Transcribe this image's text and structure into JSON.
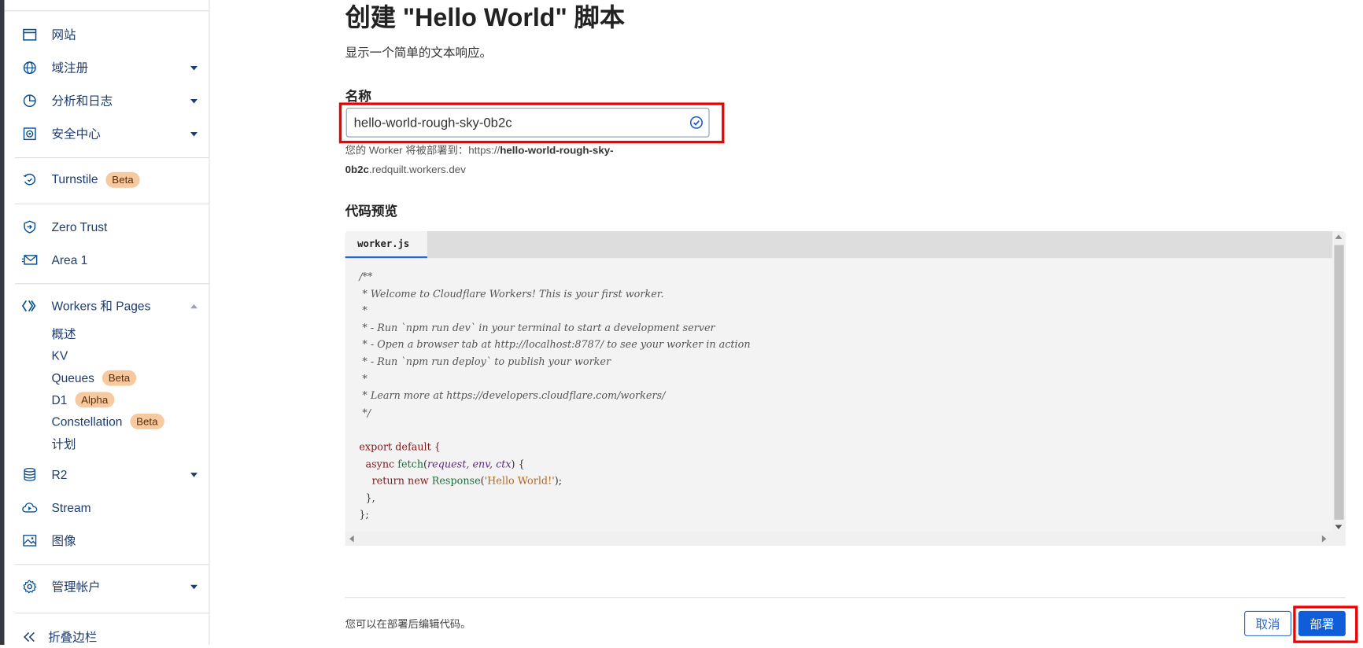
{
  "sidebar": {
    "items": [
      {
        "label": "网站",
        "icon": "browser-window-icon",
        "caret": false
      },
      {
        "label": "域注册",
        "icon": "globe-icon",
        "caret": true
      },
      {
        "label": "分析和日志",
        "icon": "pie-chart-icon",
        "caret": true
      },
      {
        "label": "安全中心",
        "icon": "shield-target-icon",
        "caret": true
      },
      {
        "label": "Turnstile",
        "icon": "turnstile-icon",
        "badge": "Beta"
      },
      {
        "label": "Zero Trust",
        "icon": "zero-trust-icon"
      },
      {
        "label": "Area 1",
        "icon": "envelope-icon"
      },
      {
        "label": "Workers 和 Pages",
        "icon": "workers-icon",
        "caret": "up"
      },
      {
        "label": "R2",
        "icon": "database-icon",
        "caret": true
      },
      {
        "label": "Stream",
        "icon": "cloud-play-icon"
      },
      {
        "label": "图像",
        "icon": "image-icon"
      },
      {
        "label": "管理帐户",
        "icon": "gear-icon",
        "caret": true
      }
    ],
    "workers_sub": [
      {
        "label": "概述"
      },
      {
        "label": "KV"
      },
      {
        "label": "Queues",
        "badge": "Beta"
      },
      {
        "label": "D1",
        "badge": "Alpha"
      },
      {
        "label": "Constellation",
        "badge": "Beta"
      },
      {
        "label": "计划"
      }
    ],
    "collapse_label": "折叠边栏"
  },
  "main": {
    "title": "创建 \"Hello World\" 脚本",
    "subtitle": "显示一个简单的文本响应。",
    "name_label": "名称",
    "name_value": "hello-world-rough-sky-0b2c",
    "deploy_hint_prefix": "您的 Worker 将被部署到：https://",
    "deploy_hint_bold_1": "hello-world-rough-sky-",
    "deploy_hint_bold_2": "0b2c",
    "deploy_hint_suffix": ".redquilt.workers.dev",
    "preview_label": "代码预览",
    "code_tab": "worker.js",
    "footer_note": "您可以在部署后编辑代码。",
    "cancel_label": "取消",
    "deploy_label": "部署"
  },
  "code": {
    "comment_lines": [
      "/**",
      " * Welcome to Cloudflare Workers! This is your first worker.",
      " *",
      " * - Run `npm run dev` in your terminal to start a development server",
      " * - Open a browser tab at http://localhost:8787/ to see your worker in action",
      " * - Run `npm run deploy` to publish your worker",
      " *",
      " * Learn more at https://developers.cloudflare.com/workers/",
      " */"
    ],
    "export_line": "export default {",
    "async_kw": "async",
    "fetch_fn": "fetch",
    "params": "request, env, ctx",
    "return_kw": "return new",
    "response_fn": "Response",
    "response_str": "'Hello World!'",
    "close_inner": "},",
    "close_outer": "};"
  },
  "colors": {
    "accent": "#0f5dd8",
    "highlight": "#ee0000",
    "nav_text": "#1f3c6e",
    "badge_bg": "#f6c9a0"
  }
}
